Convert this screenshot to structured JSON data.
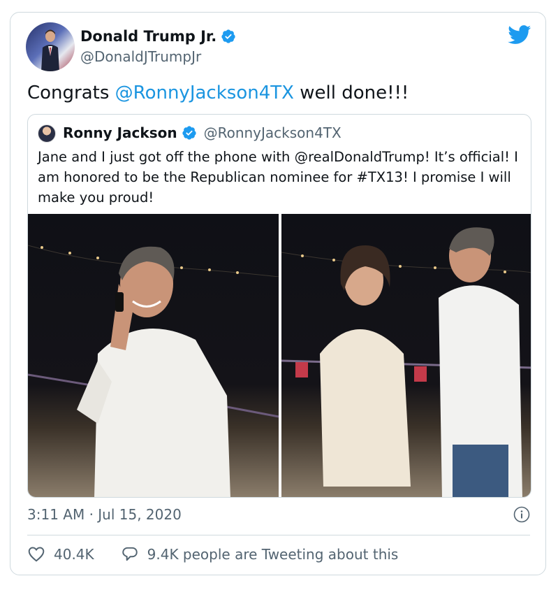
{
  "author": {
    "name": "Donald Trump Jr.",
    "handle": "@DonaldJTrumpJr"
  },
  "tweet": {
    "prefix": "Congrats ",
    "mention": "@RonnyJackson4TX",
    "suffix": " well done!!!"
  },
  "quoted": {
    "name": "Ronny Jackson",
    "handle": "@RonnyJackson4TX",
    "text": "Jane and I just got off the phone with @realDonaldTrump! It’s official! I am honored to be the Republican nominee for #TX13! I promise I will make you proud!"
  },
  "timestamp": "3:11 AM · Jul 15, 2020",
  "likes": "40.4K",
  "conversation": "9.4K people are Tweeting about this",
  "colors": {
    "link": "#1b95e0",
    "verified": "#1d9bf0",
    "secondary_text": "#536471"
  },
  "icons": [
    "verified-icon",
    "twitter-bird-icon",
    "info-icon",
    "heart-icon",
    "reply-bubble-icon"
  ]
}
